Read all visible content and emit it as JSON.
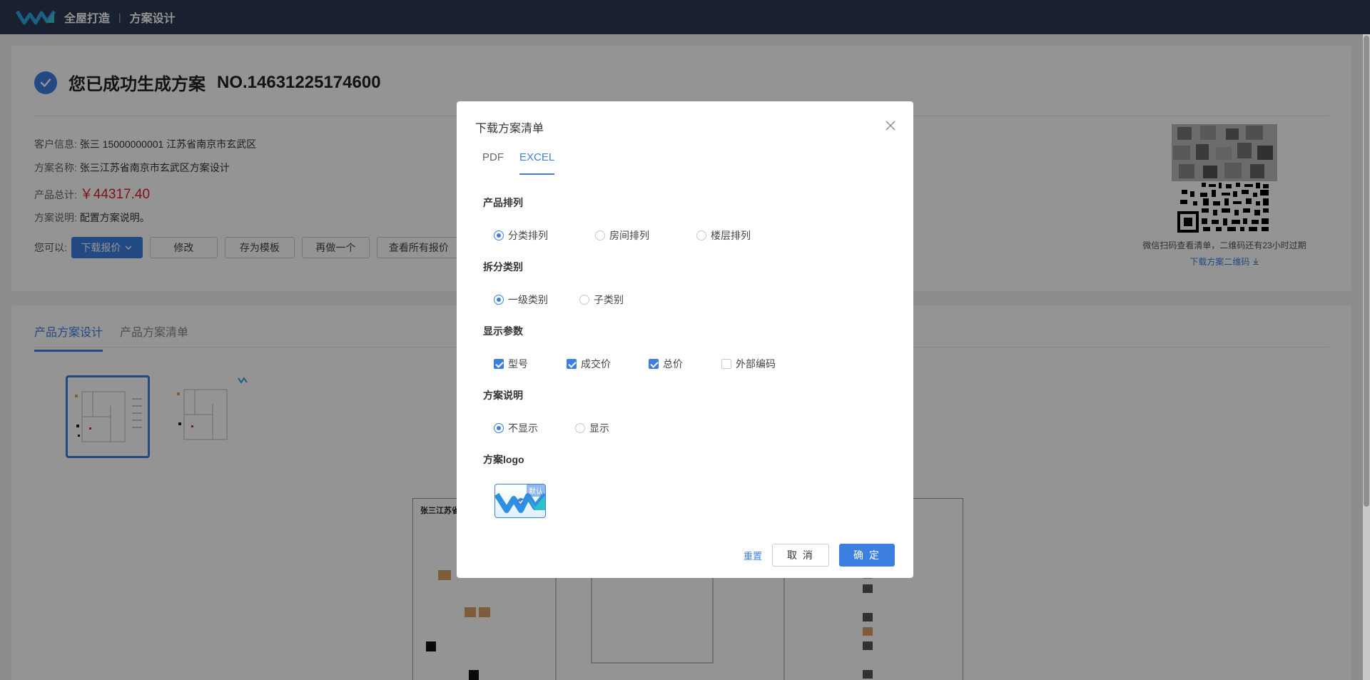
{
  "header": {
    "brand": "全屋打造",
    "separator": "|",
    "crumb": "方案设计"
  },
  "result": {
    "title": "您已成功生成方案",
    "number": "NO.14631225174600",
    "customer_label": "客户信息:",
    "customer_value": "张三  15000000001  江苏省南京市玄武区",
    "name_label": "方案名称:",
    "name_value": "张三江苏省南京市玄武区方案设计",
    "total_label": "产品总计:",
    "total_value": "￥44317.40",
    "desc_label": "方案说明:",
    "desc_value": "配置方案说明。",
    "actions_label": "您可以:",
    "buttons": {
      "download": "下载报价",
      "edit": "修改",
      "save_template": "存为模板",
      "again": "再做一个",
      "view_all": "查看所有报价"
    },
    "qr_caption": "微信扫码查看清单，二维码还有23小时过期",
    "qr_link": "下载方案二维码"
  },
  "design": {
    "tabs": [
      "产品方案设计",
      "产品方案清单"
    ],
    "plan_title": "张三江苏省"
  },
  "dialog": {
    "title": "下载方案清单",
    "tabs": [
      "PDF",
      "EXCEL"
    ],
    "active_tab": "EXCEL",
    "sections": {
      "sort": {
        "label": "产品排列",
        "options": [
          "分类排列",
          "房间排列",
          "楼层排列"
        ],
        "selected": "分类排列"
      },
      "split": {
        "label": "拆分类别",
        "options": [
          "一级类别",
          "子类别"
        ],
        "selected": "一级类别"
      },
      "params": {
        "label": "显示参数",
        "options": [
          "型号",
          "成交价",
          "总价",
          "外部编码"
        ],
        "checked": [
          "型号",
          "成交价",
          "总价"
        ]
      },
      "desc": {
        "label": "方案说明",
        "options": [
          "不显示",
          "显示"
        ],
        "selected": "不显示"
      },
      "logo": {
        "label": "方案logo",
        "tag": "默认"
      }
    },
    "reset": "重置",
    "cancel": "取 消",
    "confirm": "确 定"
  },
  "colors": {
    "primary": "#3d7fe0",
    "header_bg": "#2b3752",
    "price": "#e0202f"
  }
}
